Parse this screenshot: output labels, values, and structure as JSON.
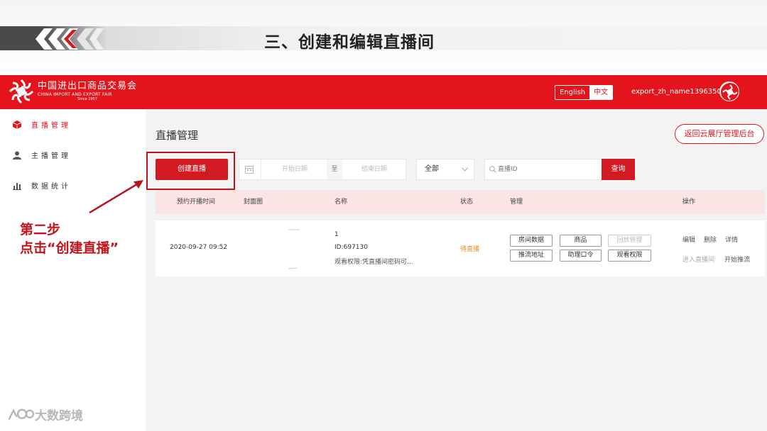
{
  "slide": {
    "title": "三、创建和编辑直播间"
  },
  "header": {
    "logo": {
      "cn": "中国进出口商品交易会",
      "en": "CHINA IMPORT AND EXPORT FAIR",
      "since": "Since 1957"
    },
    "lang_en": "English",
    "lang_zh": "中文",
    "username": "export_zh_name13963500001",
    "brand_color": "#e3141c"
  },
  "sidebar": {
    "items": [
      {
        "label": "直播管理",
        "icon": "cube-icon",
        "active": true
      },
      {
        "label": "主播管理",
        "icon": "user-icon",
        "active": false
      },
      {
        "label": "数据统计",
        "icon": "bar-chart-icon",
        "active": false
      }
    ]
  },
  "main": {
    "page_title": "直播管理",
    "back_button": "返回云展厅管理后台",
    "create_button": "创建直播",
    "date_start_placeholder": "开始日期",
    "date_to": "至",
    "date_end_placeholder": "结束日期",
    "status_select": "全部",
    "search_placeholder": "直播ID",
    "query_button": "查询",
    "columns": {
      "scheduled_time": "预约开播时间",
      "cover": "封面图",
      "name": "名称",
      "status": "状态",
      "manage": "管理",
      "actions": "操作"
    },
    "rows": [
      {
        "scheduled_time": "2020-09-27 09:52",
        "name_line1": "1",
        "name_line2": "ID:697130",
        "name_line3": "观看权限:凭直播间密码可...",
        "status": "待直播",
        "manage": {
          "room_data": "房间数据",
          "products": "商品",
          "replay": "回放管理",
          "stream_url": "推流地址",
          "assistant_code": "助理口令",
          "view_permission": "观看权限"
        },
        "actions": {
          "edit": "编辑",
          "delete": "删除",
          "detail": "详情",
          "enter": "进入直播间",
          "start_stream": "开始推流"
        }
      }
    ]
  },
  "annotation": {
    "line1": "第二步",
    "line2": "点击“创建直播”"
  },
  "watermark": "大数跨境"
}
